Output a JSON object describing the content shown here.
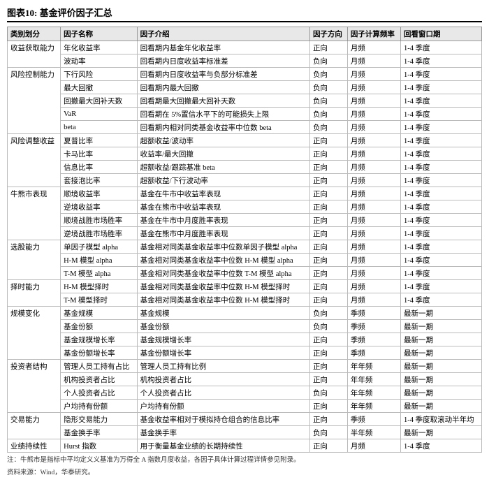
{
  "title": "图表10: 基金评价因子汇总",
  "table": {
    "headers": [
      "类别划分",
      "因子名称",
      "因子介绍",
      "因子方向",
      "因子计算频率",
      "回看窗口期"
    ],
    "rows": [
      {
        "category": "收益获取能力",
        "rowspan": 2,
        "factor": "年化收益率",
        "desc": "回看期内基金年化收益率",
        "dir": "正向",
        "freq": "月频",
        "window": "1-4 季度"
      },
      {
        "category": "",
        "factor": "波动率",
        "desc": "回看期内日度收益率标准差",
        "dir": "负向",
        "freq": "月频",
        "window": "1-4 季度"
      },
      {
        "category": "风险控制能力",
        "rowspan": 7,
        "factor": "下行风险",
        "desc": "回看期内日度收益率与负部分标准差",
        "dir": "负向",
        "freq": "月频",
        "window": "1-4 季度"
      },
      {
        "category": "",
        "factor": "最大回撤",
        "desc": "回看期内最大回撤",
        "dir": "负向",
        "freq": "月频",
        "window": "1-4 季度"
      },
      {
        "category": "",
        "factor": "回撤最大回补天数",
        "desc": "回看期最大回撤最大回补天数",
        "dir": "负向",
        "freq": "月频",
        "window": "1-4 季度"
      },
      {
        "category": "",
        "factor": "VaR",
        "desc": "回看期在 5%置信水平下的可能损失上限",
        "dir": "负向",
        "freq": "月频",
        "window": "1-4 季度"
      },
      {
        "category": "",
        "factor": "beta",
        "desc": "回看期内相对同类基金收益率中位数 beta",
        "dir": "负向",
        "freq": "月频",
        "window": "1-4 季度"
      },
      {
        "category": "风险调整收益",
        "rowspan": 4,
        "factor": "夏普比率",
        "desc": "超额收益/波动率",
        "dir": "正向",
        "freq": "月频",
        "window": "1-4 季度"
      },
      {
        "category": "",
        "factor": "卡马比率",
        "desc": "收益率/最大回撤",
        "dir": "正向",
        "freq": "月频",
        "window": "1-4 季度"
      },
      {
        "category": "",
        "factor": "信息比率",
        "desc": "超额收益/跟踪基准 beta",
        "dir": "正向",
        "freq": "月频",
        "window": "1-4 季度"
      },
      {
        "category": "",
        "factor": "套接泡比率",
        "desc": "超额收益/下行波动率",
        "dir": "正向",
        "freq": "月频",
        "window": "1-4 季度"
      },
      {
        "category": "牛熊市表现",
        "rowspan": 4,
        "factor": "顺境收益率",
        "desc": "基金在牛市中收益率表现",
        "dir": "正向",
        "freq": "月频",
        "window": "1-4 季度"
      },
      {
        "category": "",
        "factor": "逆境收益率",
        "desc": "基金在熊市中收益率表现",
        "dir": "正向",
        "freq": "月频",
        "window": "1-4 季度"
      },
      {
        "category": "",
        "factor": "顺境战胜市场胜率",
        "desc": "基金在牛市中月度胜率表现",
        "dir": "正向",
        "freq": "月频",
        "window": "1-4 季度"
      },
      {
        "category": "",
        "factor": "逆境战胜市场胜率",
        "desc": "基金在熊市中月度胜率表现",
        "dir": "正向",
        "freq": "月频",
        "window": "1-4 季度"
      },
      {
        "category": "选股能力",
        "rowspan": 4,
        "factor": "单因子模型 alpha",
        "desc": "基金相对同类基金收益率中位数单因子模型 alpha",
        "dir": "正向",
        "freq": "月频",
        "window": "1-4 季度"
      },
      {
        "category": "",
        "factor": "H-M 模型 alpha",
        "desc": "基金相对同类基金收益率中位数 H-M 模型 alpha",
        "dir": "正向",
        "freq": "月频",
        "window": "1-4 季度"
      },
      {
        "category": "",
        "factor": "T-M 模型 alpha",
        "desc": "基金相对同类基金收益率中位数 T-M 模型 alpha",
        "dir": "正向",
        "freq": "月频",
        "window": "1-4 季度"
      },
      {
        "category": "择时能力",
        "rowspan": 2,
        "factor": "H-M 模型择时",
        "desc": "基金相对同类基金收益率中位数 H-M 模型择时",
        "dir": "正向",
        "freq": "月频",
        "window": "1-4 季度"
      },
      {
        "category": "",
        "factor": "T-M 模型择时",
        "desc": "基金相对同类基金收益率中位数 H-M 模型择时",
        "dir": "正向",
        "freq": "月频",
        "window": "1-4 季度"
      },
      {
        "category": "规模变化",
        "rowspan": 4,
        "factor": "基金规模",
        "desc": "基金规模",
        "dir": "负向",
        "freq": "季频",
        "window": "最新一期"
      },
      {
        "category": "",
        "factor": "基金份额",
        "desc": "基金份额",
        "dir": "负向",
        "freq": "季频",
        "window": "最新一期"
      },
      {
        "category": "",
        "factor": "基金规模增长率",
        "desc": "基金规模增长率",
        "dir": "正向",
        "freq": "季频",
        "window": "最新一期"
      },
      {
        "category": "",
        "factor": "基金份额增长率",
        "desc": "基金份额增长率",
        "dir": "正向",
        "freq": "季频",
        "window": "最新一期"
      },
      {
        "category": "投资者结构",
        "rowspan": 4,
        "factor": "管理人员工持有占比",
        "desc": "管理人员工持有比例",
        "dir": "正向",
        "freq": "年年频",
        "window": "最新一期"
      },
      {
        "category": "",
        "factor": "机构投资者占比",
        "desc": "机构投资者占比",
        "dir": "正向",
        "freq": "年年频",
        "window": "最新一期"
      },
      {
        "category": "",
        "factor": "个人投资者占比",
        "desc": "个人投资者占比",
        "dir": "负向",
        "freq": "年年频",
        "window": "最新一期"
      },
      {
        "category": "",
        "factor": "户均持有份额",
        "desc": "户均持有份额",
        "dir": "正向",
        "freq": "年年频",
        "window": "最新一期"
      },
      {
        "category": "交易能力",
        "rowspan": 2,
        "factor": "隐形交易能力",
        "desc": "基金收益率相对于模拟持仓组合的信息比率",
        "dir": "正向",
        "freq": "季频",
        "window": "1-4 季度取滚动半年均"
      },
      {
        "category": "",
        "factor": "基金换手率",
        "desc": "基金换手率",
        "dir": "负向",
        "freq": "半年频",
        "window": "最新一期"
      },
      {
        "category": "业绩持续性",
        "rowspan": 1,
        "factor": "Hurst 指数",
        "desc": "用于衡量基金业绩的长期持续性",
        "dir": "正向",
        "freq": "月频",
        "window": "1-4 季度"
      }
    ]
  },
  "footnotes": [
    "注：牛熊市是指标中平均定义义基准为万得全 A 指数月度收益，各因子具体计算过程详情参见附录。",
    "资料来源：Wind，华泰研究。"
  ]
}
